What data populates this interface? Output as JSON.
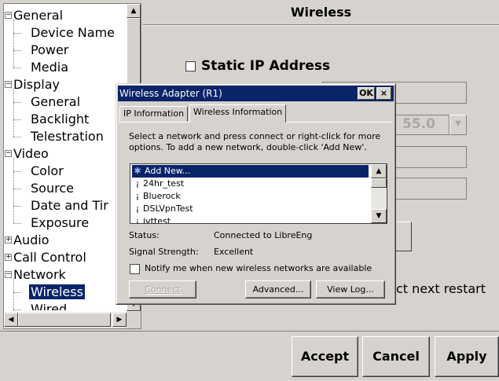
{
  "tree": {
    "items": [
      {
        "label": "General",
        "toggle": "−",
        "level": 0
      },
      {
        "label": "Device Name",
        "level": 1
      },
      {
        "label": "Power",
        "level": 1
      },
      {
        "label": "Media",
        "level": 1
      },
      {
        "label": "Display",
        "toggle": "−",
        "level": 0
      },
      {
        "label": "General",
        "level": 1
      },
      {
        "label": "Backlight",
        "level": 1
      },
      {
        "label": "Telestration",
        "level": 1
      },
      {
        "label": "Video",
        "toggle": "−",
        "level": 0
      },
      {
        "label": "Color",
        "level": 1
      },
      {
        "label": "Source",
        "level": 1
      },
      {
        "label": "Date and Tir",
        "level": 1
      },
      {
        "label": "Exposure",
        "level": 1
      },
      {
        "label": "Audio",
        "toggle": "+",
        "level": 0
      },
      {
        "label": "Call Control",
        "toggle": "+",
        "level": 0
      },
      {
        "label": "Network",
        "toggle": "−",
        "level": 0
      },
      {
        "label": "Wireless",
        "level": 1,
        "selected": true
      },
      {
        "label": "Wired",
        "level": 1
      }
    ]
  },
  "panel": {
    "title": "Wireless",
    "static_ip_label": "Static IP Address",
    "mask_value": "55.0",
    "restart_text": "ct next restart"
  },
  "bottom_buttons": {
    "accept": "Accept",
    "cancel": "Cancel",
    "apply": "Apply"
  },
  "dialog": {
    "title": "Wireless Adapter (R1)",
    "ok_label": "OK",
    "close_label": "×",
    "tabs": [
      {
        "label": "IP Information",
        "active": false
      },
      {
        "label": "Wireless Information",
        "active": true
      }
    ],
    "instructions": "Select a network and press connect or right-click for more options.  To add a new network, double-click 'Add New'.",
    "networks": [
      {
        "name": "Add New...",
        "icon": "add-new-icon",
        "selected": true
      },
      {
        "name": "24hr_test",
        "icon": "wifi-signal-icon"
      },
      {
        "name": "Bluerock",
        "icon": "wifi-signal-icon"
      },
      {
        "name": "DSLVpnTest",
        "icon": "wifi-signal-icon"
      },
      {
        "name": "ivttest",
        "icon": "wifi-signal-icon"
      }
    ],
    "status_label": "Status:",
    "status_value": "Connected to LibreEng",
    "signal_label": "Signal Strength:",
    "signal_value": "Excellent",
    "notify_label": "Notify me when new wireless networks are available",
    "notify_checked": false,
    "connect_label": "Connect",
    "advanced_label": "Advanced...",
    "viewlog_label": "View Log..."
  },
  "colors": {
    "selection": "#0a246a",
    "face": "#d6d3ce",
    "disabled_text": "#a9a7a2"
  }
}
